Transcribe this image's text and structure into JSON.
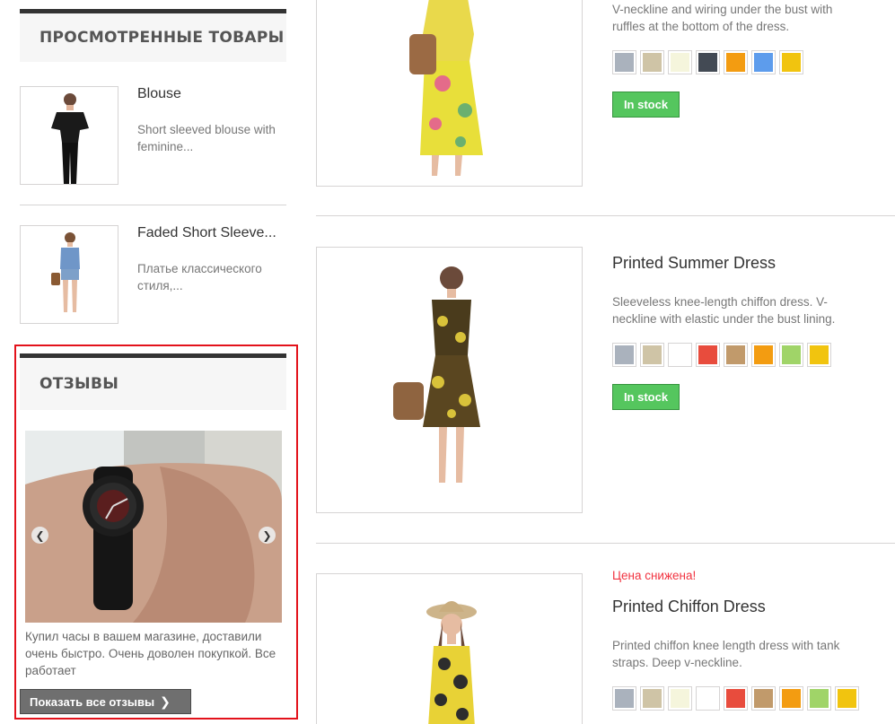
{
  "viewed_block": {
    "title": "ПРОСМОТРЕННЫЕ ТОВАРЫ",
    "items": [
      {
        "name": "Blouse",
        "desc": "Short sleeved blouse with feminine..."
      },
      {
        "name": "Faded Short Sleeve...",
        "desc": "Платье классического стиля,..."
      }
    ]
  },
  "reviews_block": {
    "title": "ОТЗЫВЫ",
    "prev_icon": "chevron-left-icon",
    "next_icon": "chevron-right-icon",
    "review_text": "Купил часы в вашем магазине, доставили очень быстро. Очень доволен покупкой. Все работает",
    "button_label": "Показать все отзывы",
    "highlight_color": "#e3121b"
  },
  "products": [
    {
      "name": "",
      "desc": "V-neckline and wiring under the bust with ruffles at the bottom of the dress.",
      "colors": [
        "#aab2bd",
        "#cfc4a6",
        "#f5f5dc",
        "#434a54",
        "#f39c11",
        "#5d9cec",
        "#f1c40f"
      ],
      "stock": "In stock"
    },
    {
      "name": "Printed Summer Dress",
      "desc": "Sleeveless knee-length chiffon dress. V-neckline with elastic under the bust lining.",
      "colors": [
        "#aab2bd",
        "#cfc4a6",
        "#ffffff",
        "#e84c3d",
        "#c19a6b",
        "#f39c11",
        "#a0d468",
        "#f1c40f"
      ],
      "stock": "In stock"
    },
    {
      "name": "Printed Chiffon Dress",
      "badge": "Цена снижена!",
      "desc": "Printed chiffon knee length dress with tank straps. Deep v-neckline.",
      "colors": [
        "#aab2bd",
        "#cfc4a6",
        "#f5f5dc",
        "#ffffff",
        "#e84c3d",
        "#c19a6b",
        "#f39c11",
        "#a0d468",
        "#f1c40f"
      ]
    }
  ],
  "colors": {
    "in_stock_green": "#55c65e",
    "price_reduced_red": "#f13340",
    "block_border": "#333333"
  }
}
